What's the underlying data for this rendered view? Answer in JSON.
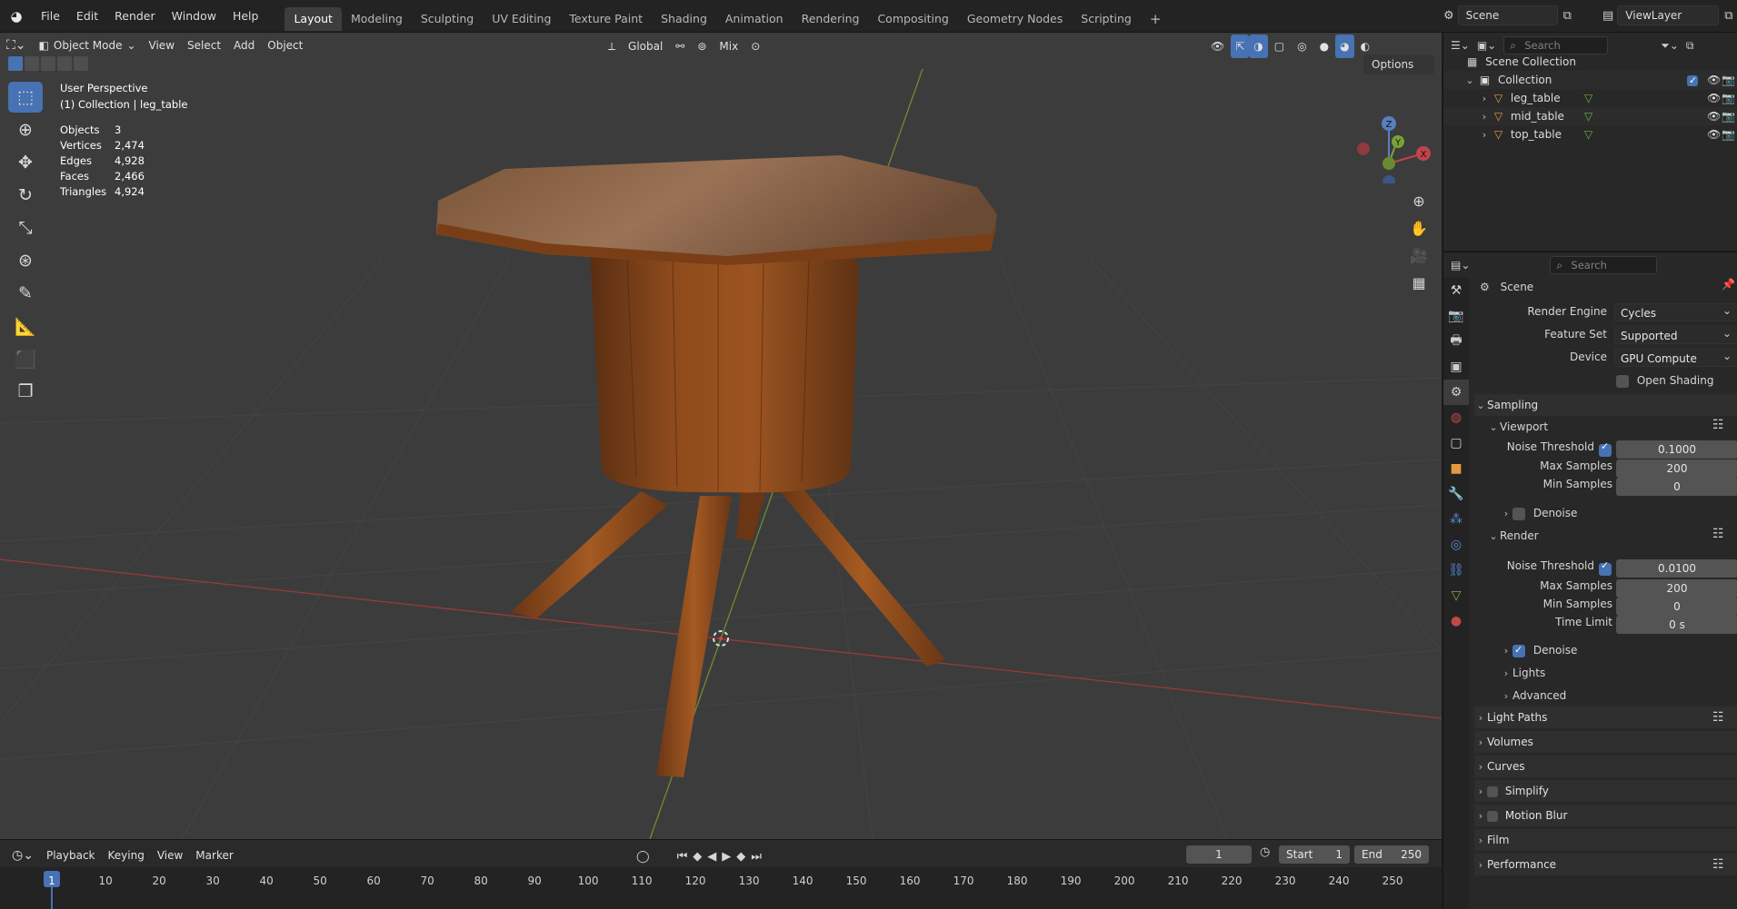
{
  "topbar": {
    "menus": [
      "File",
      "Edit",
      "Render",
      "Window",
      "Help"
    ],
    "workspaces": [
      "Layout",
      "Modeling",
      "Sculpting",
      "UV Editing",
      "Texture Paint",
      "Shading",
      "Animation",
      "Rendering",
      "Compositing",
      "Geometry Nodes",
      "Scripting"
    ],
    "active_workspace": "Layout",
    "add_workspace": "+",
    "scene_label": "Scene",
    "view_layer_label": "ViewLayer"
  },
  "viewport_header": {
    "mode": "Object Mode",
    "menus": [
      "View",
      "Select",
      "Add",
      "Object"
    ],
    "orientation": "Global",
    "snap_mix": "Mix",
    "options": "Options"
  },
  "viewport_overlay": {
    "view_name": "User Perspective",
    "collection_line": "(1) Collection | leg_table",
    "stats": [
      {
        "key": "Objects",
        "value": "3"
      },
      {
        "key": "Vertices",
        "value": "2,474"
      },
      {
        "key": "Edges",
        "value": "4,928"
      },
      {
        "key": "Faces",
        "value": "2,466"
      },
      {
        "key": "Triangles",
        "value": "4,924"
      }
    ]
  },
  "gizmo": {
    "x": "X",
    "y": "Y",
    "z": "Z"
  },
  "outliner": {
    "search_placeholder": "Search",
    "scene_collection": "Scene Collection",
    "collection": "Collection",
    "objects": [
      "leg_table",
      "mid_table",
      "top_table"
    ]
  },
  "properties": {
    "search_placeholder": "Search",
    "context": "Scene",
    "render_engine_label": "Render Engine",
    "render_engine": "Cycles",
    "feature_set_label": "Feature Set",
    "feature_set": "Supported",
    "device_label": "Device",
    "device": "GPU Compute",
    "osl_label": "Open Shading Language",
    "sampling": "Sampling",
    "viewport": "Viewport",
    "vp_noise_label": "Noise Threshold",
    "vp_noise": "0.1000",
    "vp_max_label": "Max Samples",
    "vp_max": "200",
    "vp_min_label": "Min Samples",
    "vp_min": "0",
    "vp_denoise": "Denoise",
    "render": "Render",
    "r_noise_label": "Noise Threshold",
    "r_noise": "0.0100",
    "r_max_label": "Max Samples",
    "r_max": "200",
    "r_min_label": "Min Samples",
    "r_min": "0",
    "r_time_label": "Time Limit",
    "r_time": "0 s",
    "r_denoise": "Denoise",
    "lights": "Lights",
    "advanced": "Advanced",
    "light_paths": "Light Paths",
    "volumes": "Volumes",
    "curves": "Curves",
    "simplify": "Simplify",
    "motion_blur": "Motion Blur",
    "film": "Film",
    "performance": "Performance"
  },
  "timeline": {
    "menus": [
      "Playback",
      "Keying",
      "View",
      "Marker"
    ],
    "current_frame": "1",
    "start_label": "Start",
    "start": "1",
    "end_label": "End",
    "end": "250",
    "ruler": [
      "1",
      "10",
      "20",
      "30",
      "40",
      "50",
      "60",
      "70",
      "80",
      "90",
      "100",
      "110",
      "120",
      "130",
      "140",
      "150",
      "160",
      "170",
      "180",
      "190",
      "200",
      "210",
      "220",
      "230",
      "240",
      "250"
    ]
  }
}
